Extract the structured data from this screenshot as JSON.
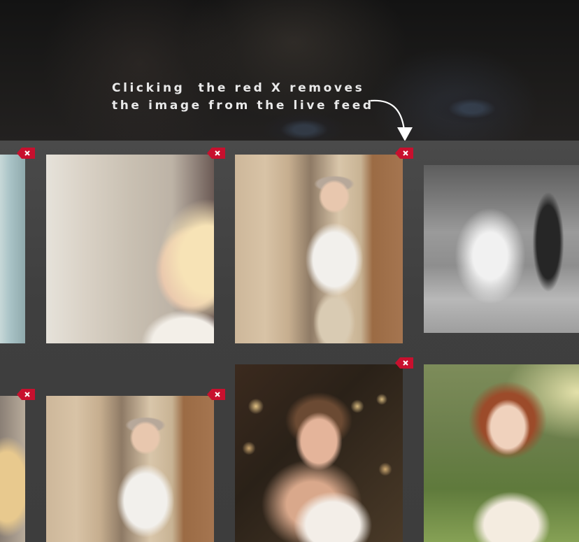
{
  "banner": {
    "caption_line1": "Clicking  the red X removes",
    "caption_line2": "the image from the live feed"
  },
  "colors": {
    "remove_tag": "#c8102e",
    "background": "#3c3c3c",
    "banner": "#1a1a1a",
    "caption_text": "#e9e9e9"
  },
  "icons": {
    "remove": "close-tag-icon",
    "arrow": "curved-arrow-down-icon"
  },
  "feed": {
    "tiles": [
      {
        "name": "photo-bride-partial"
      },
      {
        "name": "photo-flower-girl"
      },
      {
        "name": "photo-ring-bearer"
      },
      {
        "name": "photo-couple-black-and-white"
      },
      {
        "name": "photo-flower-girl-partial"
      },
      {
        "name": "photo-ring-bearer-2"
      },
      {
        "name": "photo-bride-portrait"
      },
      {
        "name": "photo-redhead-girl"
      }
    ]
  }
}
